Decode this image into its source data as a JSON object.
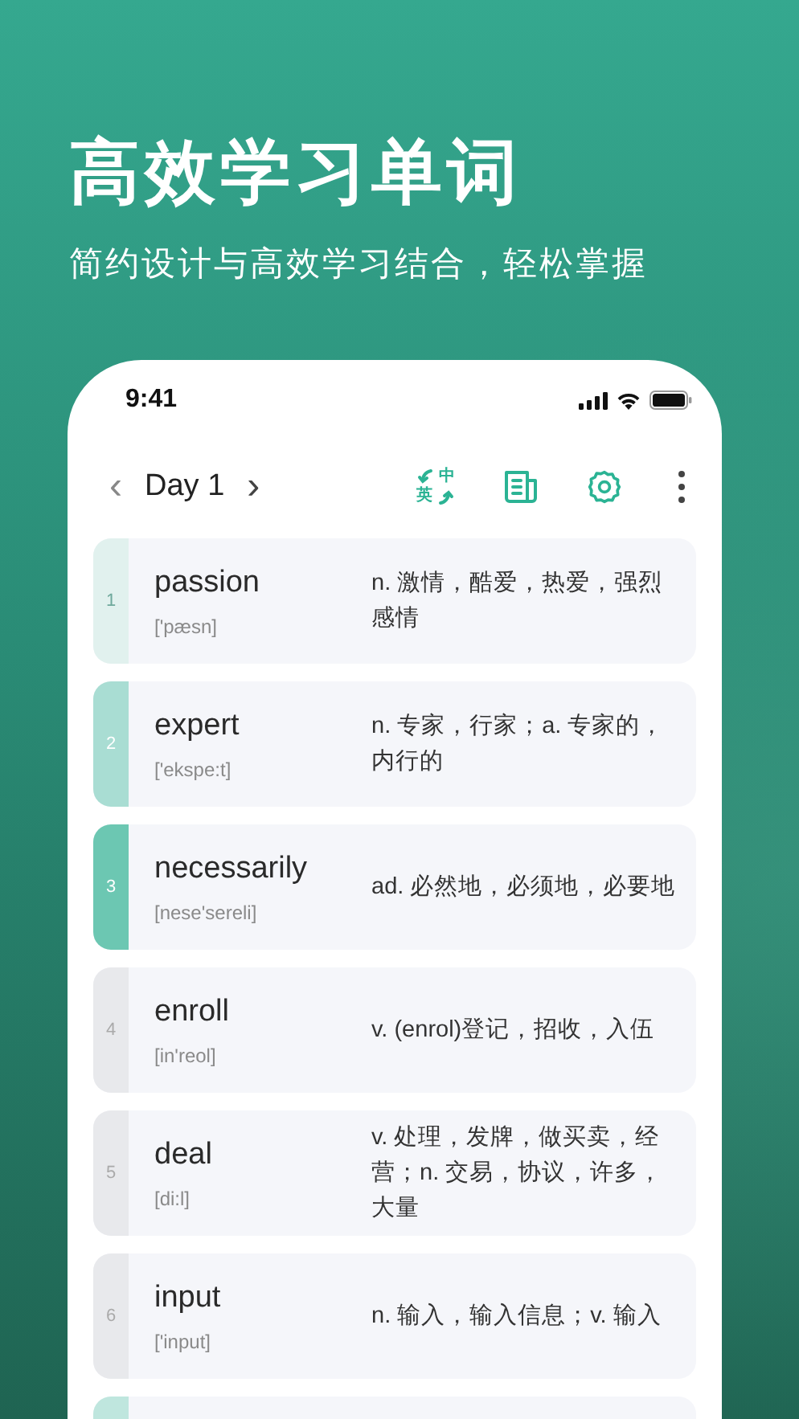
{
  "hero": {
    "title": "高效学习单词",
    "subtitle": "简约设计与高效学习结合，轻松掌握"
  },
  "status_bar": {
    "time": "9:41"
  },
  "toolbar": {
    "prev": "‹",
    "title": "Day 1",
    "next": "›",
    "actions": [
      {
        "kind": "language",
        "top": "中",
        "bottom": "英"
      },
      {
        "kind": "article"
      },
      {
        "kind": "settings"
      },
      {
        "kind": "more"
      }
    ]
  },
  "words": [
    {
      "number": "1",
      "word": "passion",
      "phonetic": "['pæsn]",
      "meaning": "n. 激情，酷爱，热爱，强烈感情",
      "color": "#e1f1ee"
    },
    {
      "number": "2",
      "word": "expert",
      "phonetic": "['ekspe:t]",
      "meaning": "n. 专家，行家；a. 专家的，内行的",
      "color": "#a9ddd3"
    },
    {
      "number": "3",
      "word": "necessarily",
      "phonetic": "[nese'sereli]",
      "meaning": "ad. 必然地，必须地，必要地",
      "color": "#6cc7b2"
    },
    {
      "number": "4",
      "word": "enroll",
      "phonetic": "[in'reol]",
      "meaning": "v. (enrol)登记，招收，入伍",
      "color": "#e8e9ec"
    },
    {
      "number": "5",
      "word": "deal",
      "phonetic": "[di:l]",
      "meaning": "v. 处理，发牌，做买卖，经营；n. 交易，协议，许多，大量",
      "color": "#e8e9ec"
    },
    {
      "number": "6",
      "word": "input",
      "phonetic": "['input]",
      "meaning": "n. 输入，输入信息；v. 输入",
      "color": "#e8e9ec"
    },
    {
      "color": "#bfe6de"
    }
  ]
}
